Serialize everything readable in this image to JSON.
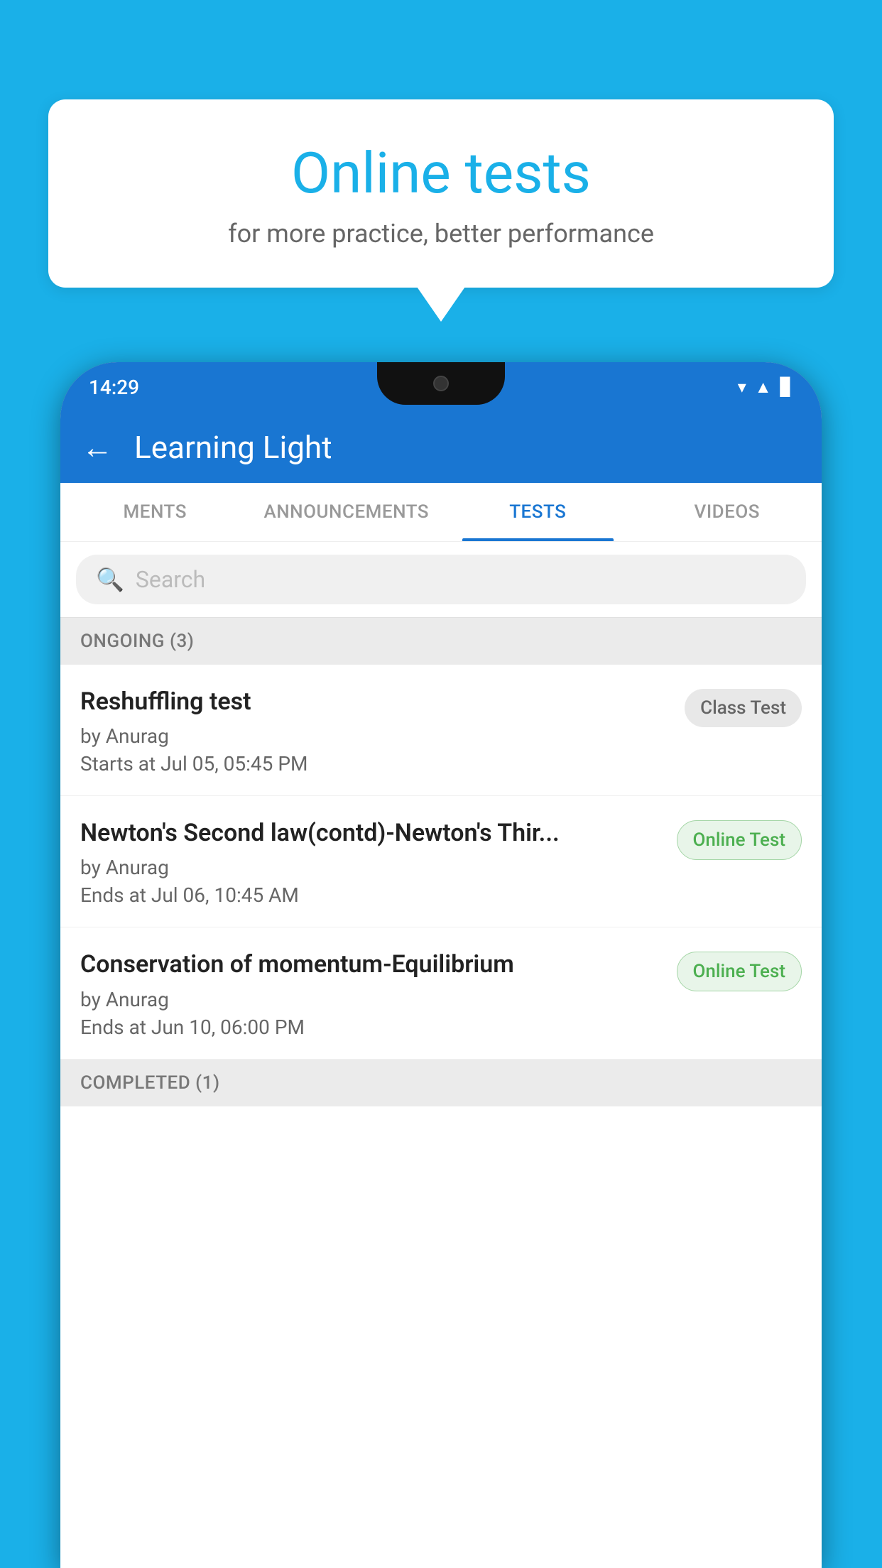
{
  "background": {
    "color": "#1ab0e8"
  },
  "bubble": {
    "title": "Online tests",
    "subtitle": "for more practice, better performance"
  },
  "phone": {
    "status": {
      "time": "14:29",
      "icons": [
        "wifi",
        "signal",
        "battery"
      ]
    },
    "header": {
      "back_label": "←",
      "title": "Learning Light"
    },
    "tabs": [
      {
        "label": "MENTS",
        "active": false
      },
      {
        "label": "ANNOUNCEMENTS",
        "active": false
      },
      {
        "label": "TESTS",
        "active": true
      },
      {
        "label": "VIDEOS",
        "active": false
      }
    ],
    "search": {
      "placeholder": "Search"
    },
    "sections": [
      {
        "header": "ONGOING (3)",
        "items": [
          {
            "name": "Reshuffling test",
            "author": "by Anurag",
            "date_label": "Starts at",
            "date": "Jul 05, 05:45 PM",
            "badge": "Class Test",
            "badge_type": "class"
          },
          {
            "name": "Newton's Second law(contd)-Newton's Thir...",
            "author": "by Anurag",
            "date_label": "Ends at",
            "date": "Jul 06, 10:45 AM",
            "badge": "Online Test",
            "badge_type": "online"
          },
          {
            "name": "Conservation of momentum-Equilibrium",
            "author": "by Anurag",
            "date_label": "Ends at",
            "date": "Jun 10, 06:00 PM",
            "badge": "Online Test",
            "badge_type": "online"
          }
        ]
      },
      {
        "header": "COMPLETED (1)",
        "items": []
      }
    ]
  }
}
